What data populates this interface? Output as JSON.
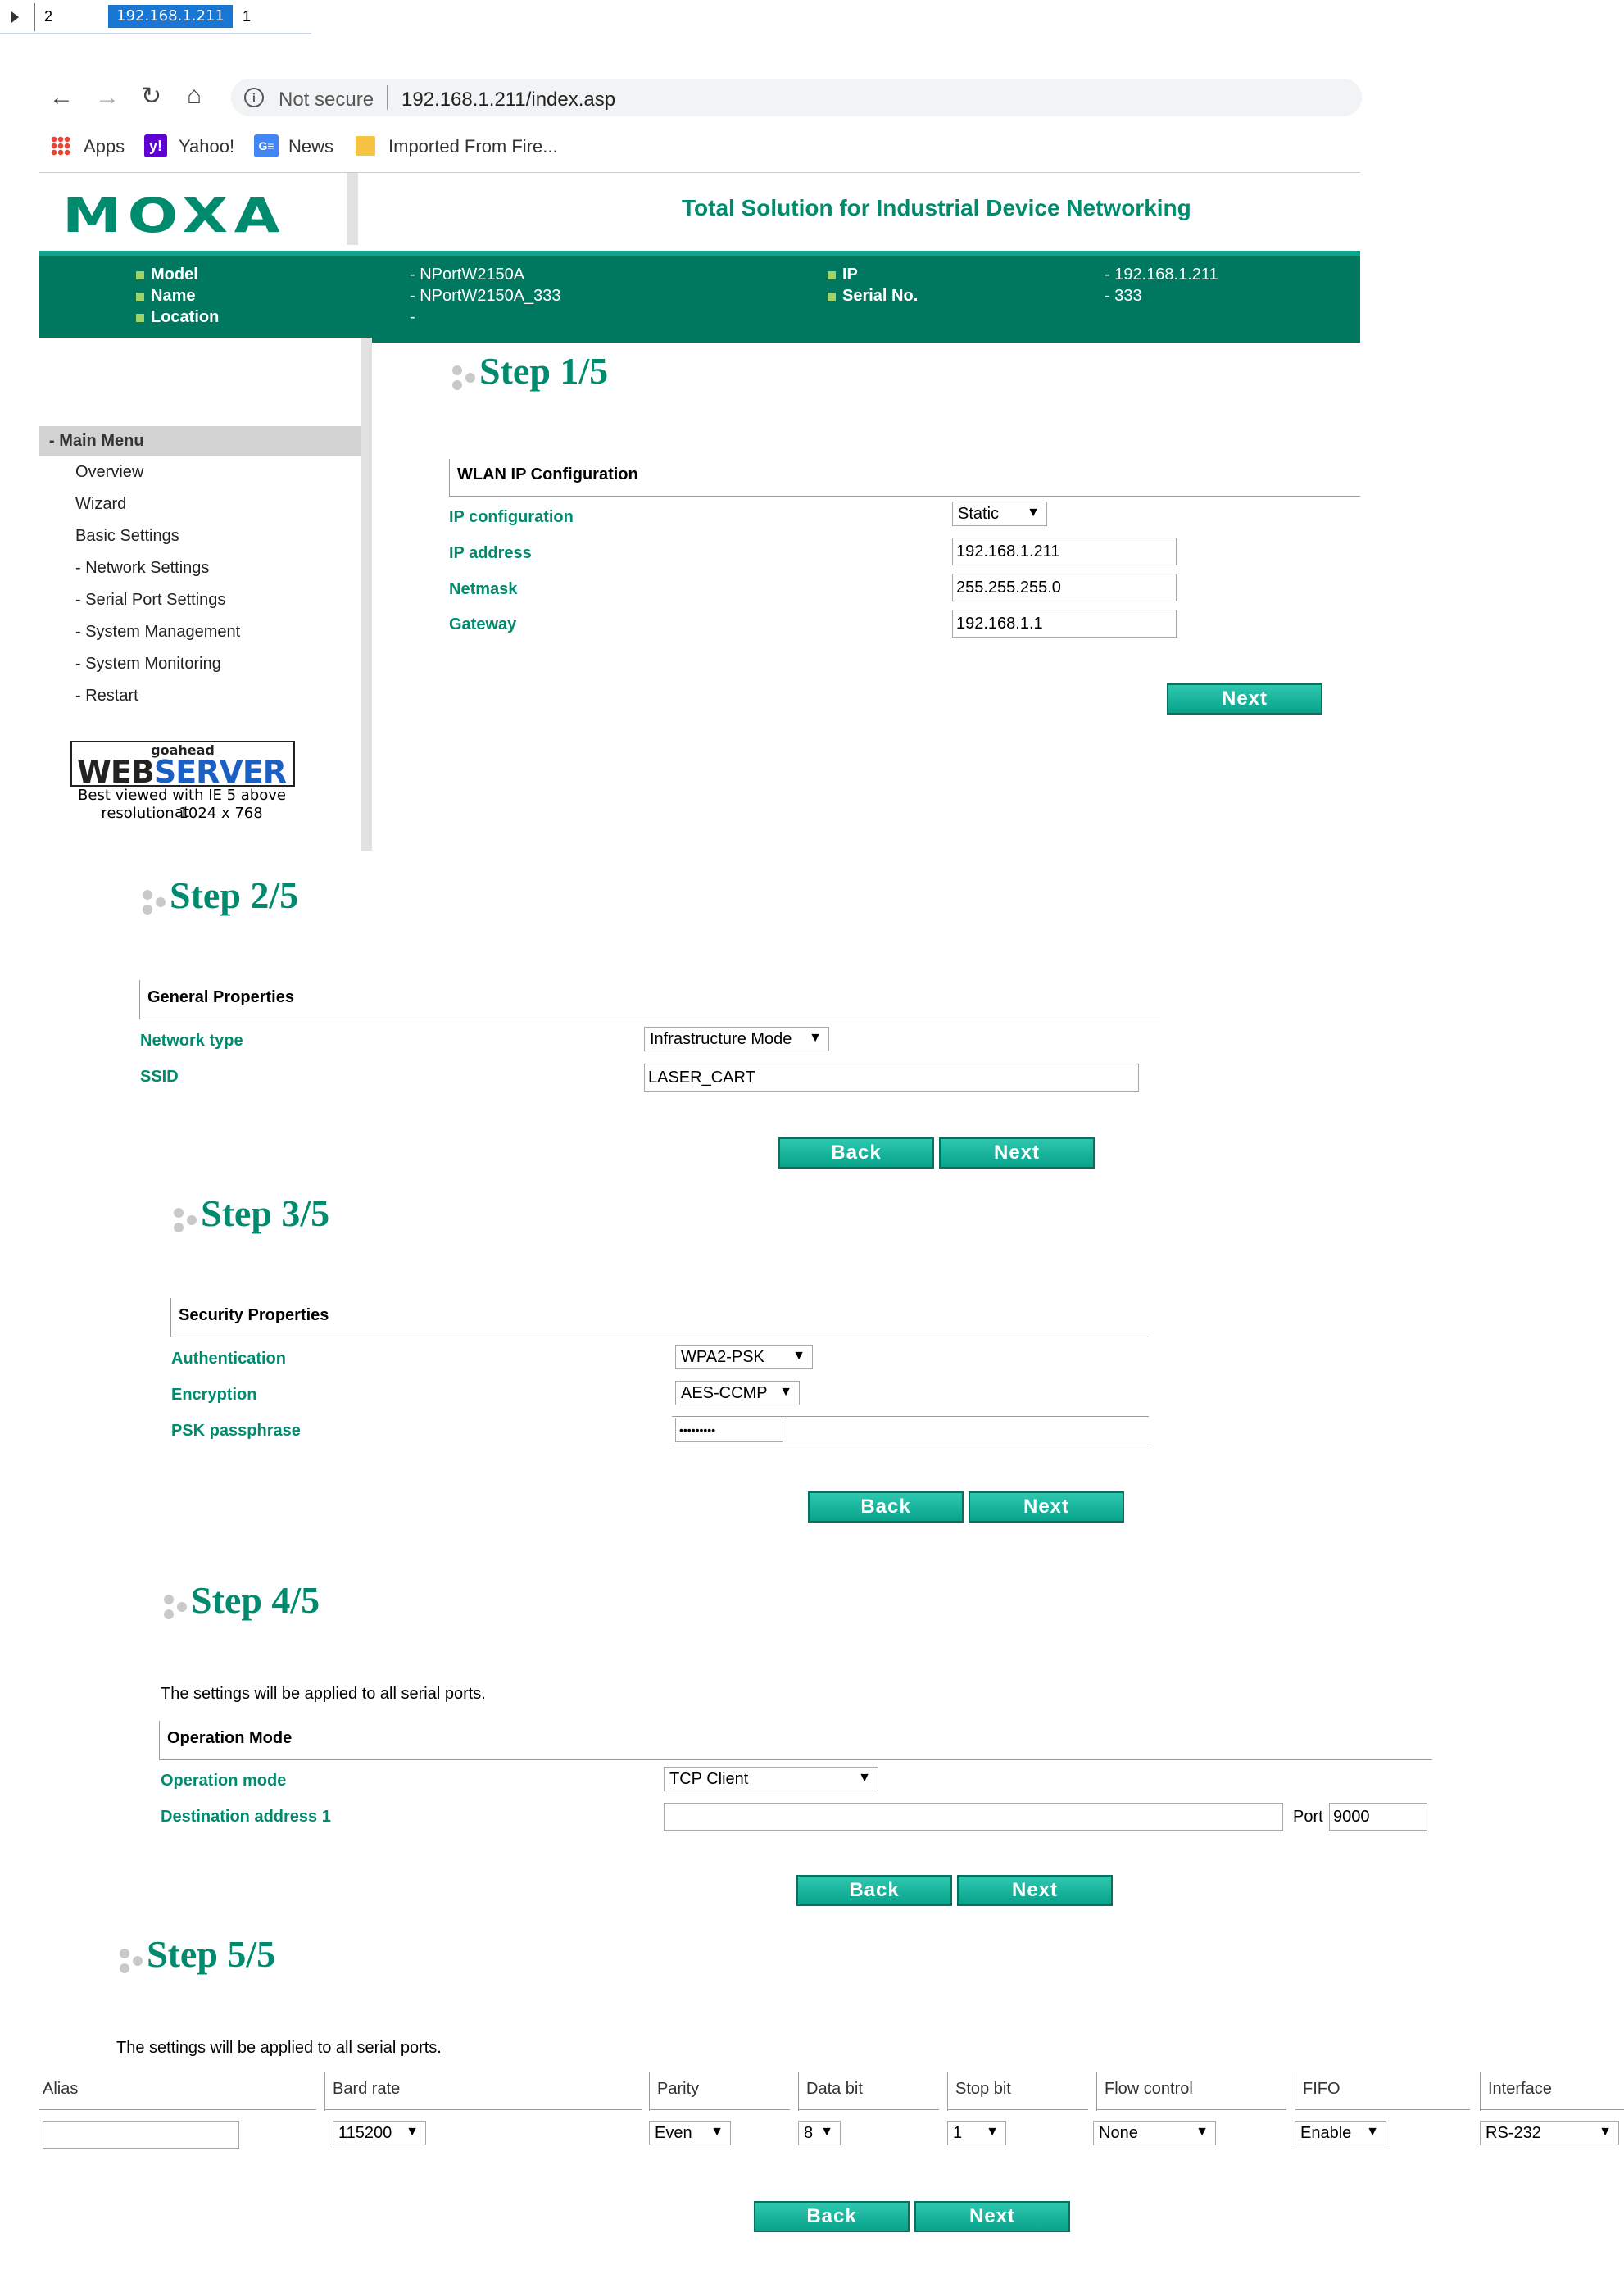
{
  "spreadsheet_row": {
    "row_num": "2",
    "ip": "192.168.1.211",
    "value": "1"
  },
  "browser": {
    "security": "Not secure",
    "url": "192.168.1.211/index.asp",
    "bookmarks": [
      "Apps",
      "Yahoo!",
      "News",
      "Imported From Fire..."
    ]
  },
  "header": {
    "logo": "MOXA",
    "tagline": "Total Solution for Industrial Device Networking",
    "info_labels": [
      "Model",
      "Name",
      "Location"
    ],
    "info_values": [
      "- NPortW2150A",
      "- NPortW2150A_333",
      "-"
    ],
    "info_labels2": [
      "IP",
      "Serial No."
    ],
    "info_values2": [
      "- 192.168.1.211",
      "- 333"
    ]
  },
  "sidebar": {
    "title": "- Main Menu",
    "items": [
      "Overview",
      "Wizard",
      "Basic Settings",
      "- Network Settings",
      "- Serial Port Settings",
      "- System Management",
      "- System Monitoring",
      "- Restart"
    ],
    "badge_top": "goahead",
    "badge_main_a": "WEB",
    "badge_main_b": "SERVER",
    "badge_note1": "Best viewed with IE 5 above at",
    "badge_note2": "resolution 1024 x 768"
  },
  "step1": {
    "title": "Step 1/5",
    "section": "WLAN IP Configuration",
    "labels": [
      "IP configuration",
      "IP address",
      "Netmask",
      "Gateway"
    ],
    "ip_config": "Static",
    "ip_address": "192.168.1.211",
    "netmask": "255.255.255.0",
    "gateway": "192.168.1.1",
    "next": "Next"
  },
  "step2": {
    "title": "Step 2/5",
    "section": "General Properties",
    "labels": [
      "Network type",
      "SSID"
    ],
    "network_type": "Infrastructure Mode",
    "ssid": "LASER_CART",
    "back": "Back",
    "next": "Next"
  },
  "step3": {
    "title": "Step 3/5",
    "section": "Security Properties",
    "labels": [
      "Authentication",
      "Encryption",
      "PSK passphrase"
    ],
    "authentication": "WPA2-PSK",
    "encryption": "AES-CCMP",
    "passphrase": "•••••••••",
    "back": "Back",
    "next": "Next"
  },
  "step4": {
    "title": "Step 4/5",
    "note": "The settings will be applied to all serial ports.",
    "section": "Operation Mode",
    "labels": [
      "Operation mode",
      "Destination address 1"
    ],
    "operation_mode": "TCP Client",
    "destination": "",
    "port_label": "Port",
    "port": "9000",
    "back": "Back",
    "next": "Next"
  },
  "step5": {
    "title": "Step 5/5",
    "note": "The settings will be applied to all serial ports.",
    "columns": [
      "Alias",
      "Bard rate",
      "Parity",
      "Data bit",
      "Stop bit",
      "Flow control",
      "FIFO",
      "Interface"
    ],
    "alias": "",
    "baud": "115200",
    "parity": "Even",
    "data_bit": "8",
    "stop_bit": "1",
    "flow_control": "None",
    "fifo": "Enable",
    "interface": "RS-232",
    "back": "Back",
    "next": "Next"
  },
  "colors": {
    "accent": "#008b6e",
    "header_bar": "#00785f",
    "button": "#07a38a"
  }
}
